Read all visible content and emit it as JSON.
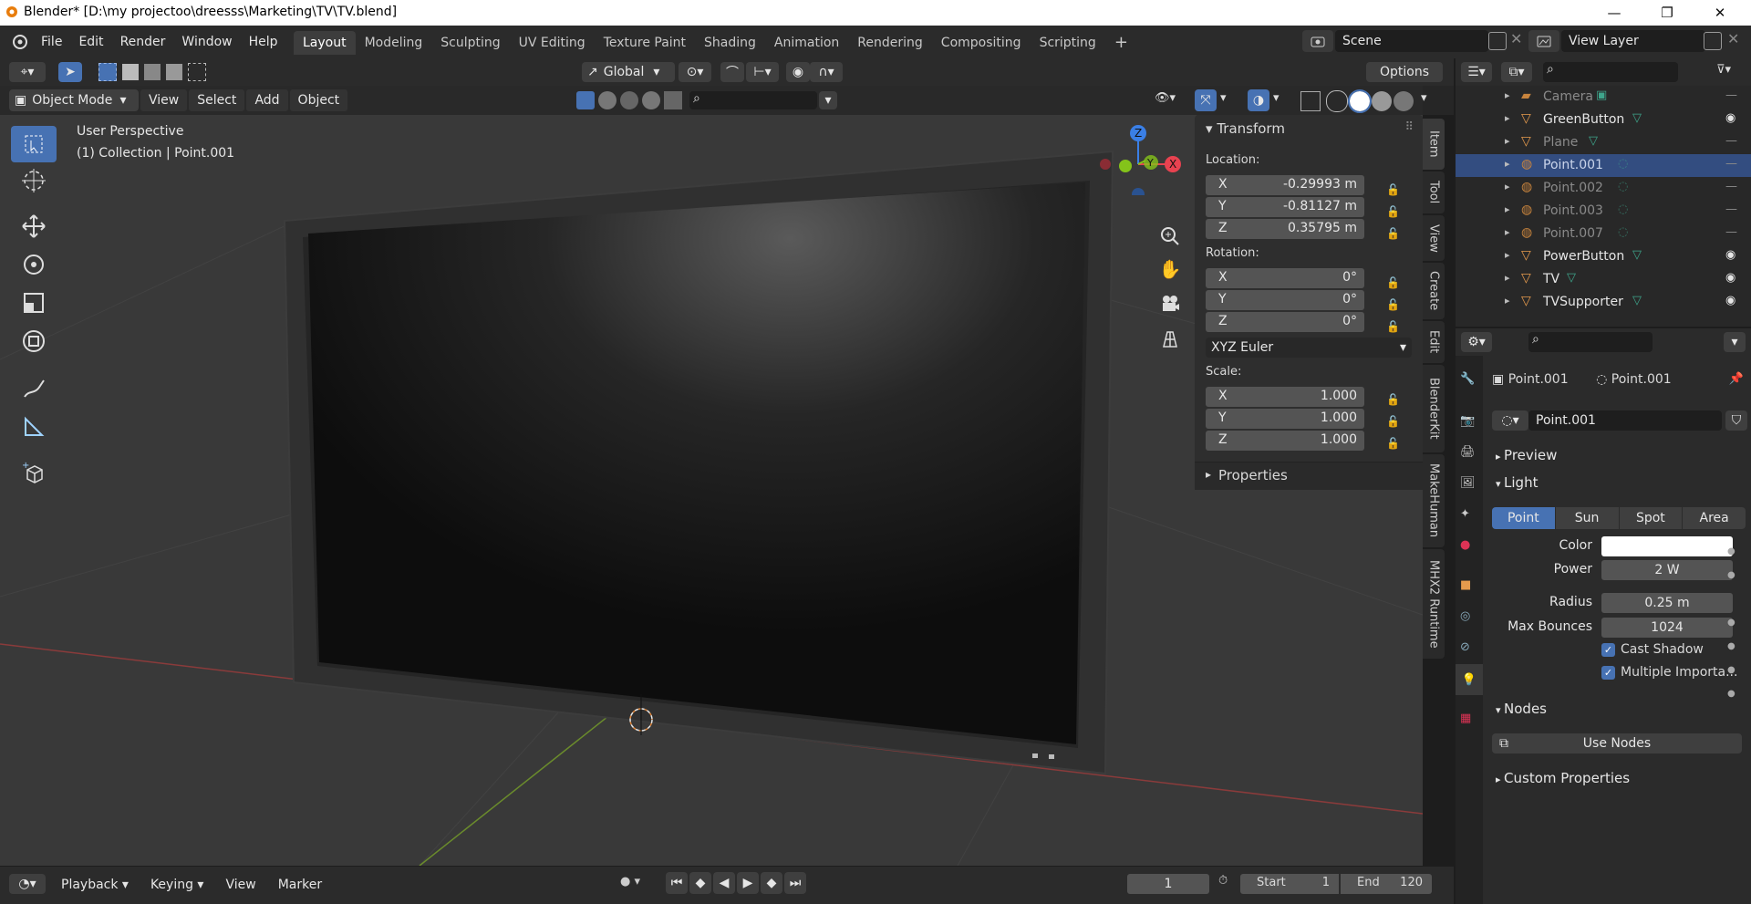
{
  "window": {
    "title": "Blender* [D:\\my projectoo\\dreesss\\Marketing\\TV\\TV.blend]",
    "min": "—",
    "max": "❐",
    "close": "✕"
  },
  "menu": [
    "File",
    "Edit",
    "Render",
    "Window",
    "Help"
  ],
  "workspaces": [
    "Layout",
    "Modeling",
    "Sculpting",
    "UV Editing",
    "Texture Paint",
    "Shading",
    "Animation",
    "Rendering",
    "Compositing",
    "Scripting"
  ],
  "active_workspace": "Layout",
  "scene": {
    "name": "Scene",
    "view_layer": "View Layer"
  },
  "toolbar": {
    "orientation": "Global",
    "options": "Options"
  },
  "header": {
    "mode": "Object Mode",
    "menus": [
      "View",
      "Select",
      "Add",
      "Object"
    ]
  },
  "viewport": {
    "perspective": "User Perspective",
    "collection": "(1) Collection | Point.001"
  },
  "gizmo": {
    "x": "X",
    "y": "Y",
    "z": "Z"
  },
  "npanel": {
    "transform_title": "Transform",
    "location_label": "Location:",
    "location": [
      {
        "axis": "X",
        "value": "-0.29993 m"
      },
      {
        "axis": "Y",
        "value": "-0.81127 m"
      },
      {
        "axis": "Z",
        "value": "0.35795 m"
      }
    ],
    "rotation_label": "Rotation:",
    "rotation": [
      {
        "axis": "X",
        "value": "0°"
      },
      {
        "axis": "Y",
        "value": "0°"
      },
      {
        "axis": "Z",
        "value": "0°"
      }
    ],
    "rotation_mode": "XYZ Euler",
    "scale_label": "Scale:",
    "scale": [
      {
        "axis": "X",
        "value": "1.000"
      },
      {
        "axis": "Y",
        "value": "1.000"
      },
      {
        "axis": "Z",
        "value": "1.000"
      }
    ],
    "properties_title": "Properties",
    "tabs": [
      "Item",
      "Tool",
      "View",
      "Create",
      "Edit",
      "BlenderKit",
      "MakeHuman",
      "MHX2 Runtime"
    ]
  },
  "outliner": {
    "items": [
      {
        "name": "Camera",
        "type": "camera",
        "visible": false
      },
      {
        "name": "GreenButton",
        "type": "mesh",
        "visible": true
      },
      {
        "name": "Plane",
        "type": "mesh",
        "visible": false
      },
      {
        "name": "Point.001",
        "type": "light",
        "visible": false,
        "selected": true
      },
      {
        "name": "Point.002",
        "type": "light",
        "visible": false
      },
      {
        "name": "Point.003",
        "type": "light",
        "visible": false
      },
      {
        "name": "Point.007",
        "type": "light",
        "visible": false
      },
      {
        "name": "PowerButton",
        "type": "mesh",
        "visible": true
      },
      {
        "name": "TV",
        "type": "mesh",
        "visible": true
      },
      {
        "name": "TVSupporter",
        "type": "mesh",
        "visible": true
      }
    ]
  },
  "properties": {
    "breadcrumb_object": "Point.001",
    "breadcrumb_data": "Point.001",
    "datablock": "Point.001",
    "sections": {
      "preview": "Preview",
      "light": "Light",
      "nodes": "Nodes",
      "custom": "Custom Properties"
    },
    "light_types": [
      "Point",
      "Sun",
      "Spot",
      "Area"
    ],
    "active_light_type": "Point",
    "color_label": "Color",
    "color_value": "#ffffff",
    "power_label": "Power",
    "power": "2 W",
    "radius_label": "Radius",
    "radius": "0.25 m",
    "bounces_label": "Max Bounces",
    "bounces": "1024",
    "cast_shadow": "Cast Shadow",
    "multiple_importance": "Multiple Importa...",
    "use_nodes": "Use Nodes"
  },
  "timeline": {
    "menus": [
      "Playback",
      "Keying",
      "View",
      "Marker"
    ],
    "current_frame": "1",
    "start_label": "Start",
    "start": "1",
    "end_label": "End",
    "end": "120"
  },
  "colors": {
    "accent": "#4772b3",
    "selected_row": "#334d80",
    "mesh_icon": "#e59a4d",
    "light_icon": "#3ea58b",
    "x_axis": "#e84250",
    "y_axis": "#84c31a",
    "z_axis": "#3a7fe6"
  }
}
